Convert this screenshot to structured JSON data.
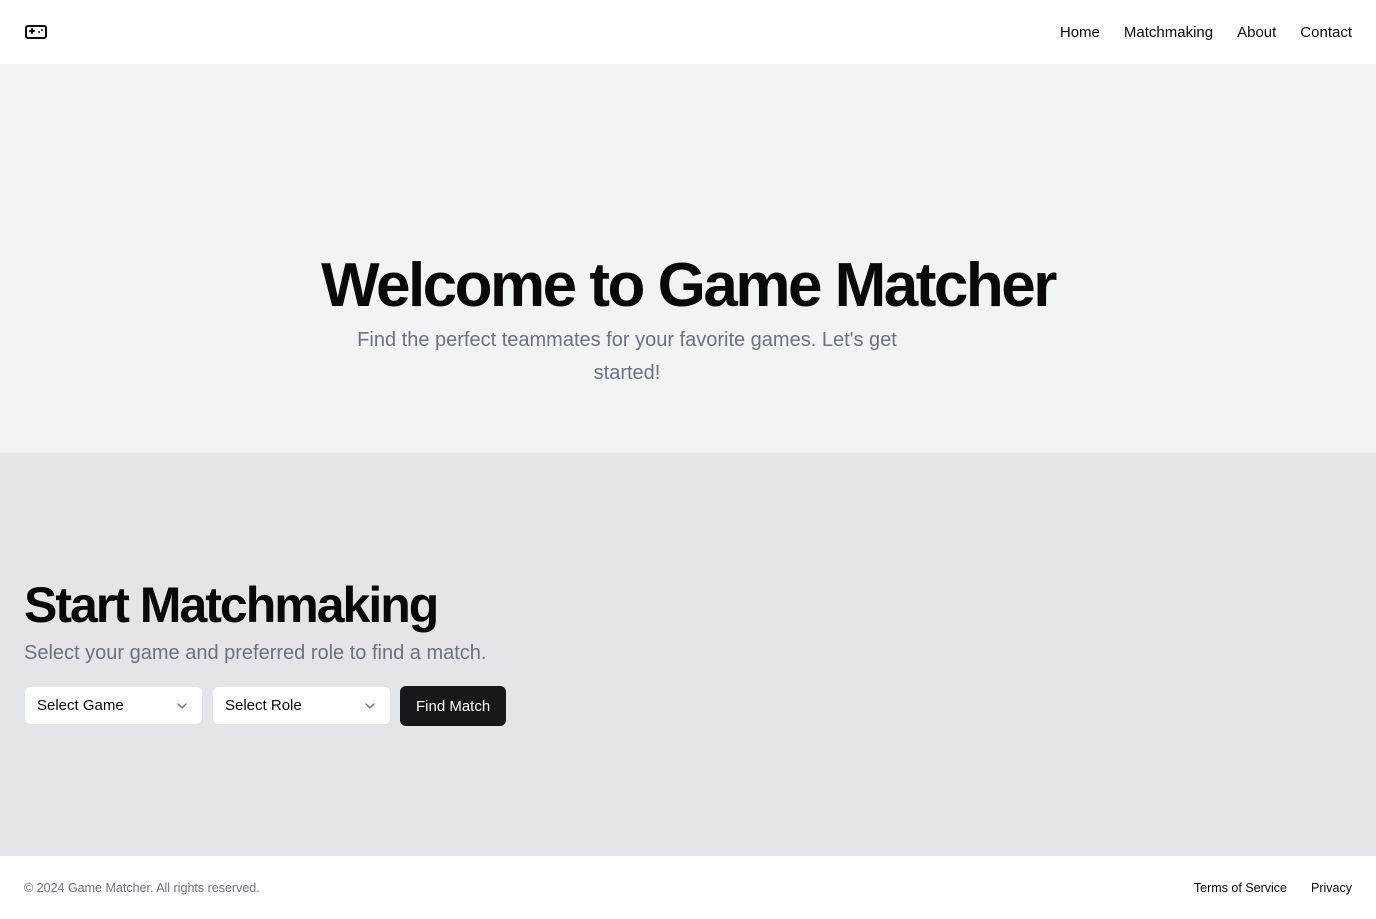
{
  "header": {
    "logo_icon": "gamepad-icon",
    "nav": [
      {
        "label": "Home"
      },
      {
        "label": "Matchmaking"
      },
      {
        "label": "About"
      },
      {
        "label": "Contact"
      }
    ]
  },
  "hero": {
    "title": "Welcome to Game Matcher",
    "subtitle": "Find the perfect teammates for your favorite games. Let's get started!"
  },
  "matchmaking": {
    "title": "Start Matchmaking",
    "subtitle": "Select your game and preferred role to find a match.",
    "game_select": {
      "value": "Select Game",
      "icon": "chevron-down-icon"
    },
    "role_select": {
      "value": "Select Role",
      "icon": "chevron-down-icon"
    },
    "button_label": "Find Match"
  },
  "footer": {
    "copyright": "© 2024 Game Matcher. All rights reserved.",
    "links": [
      {
        "label": "Terms of Service"
      },
      {
        "label": "Privacy"
      }
    ]
  },
  "colors": {
    "hero_bg": "#f2f3f5",
    "matchmaking_bg": "#e4e5e9",
    "primary_button": "#18181b",
    "muted_text": "#6b7280"
  }
}
